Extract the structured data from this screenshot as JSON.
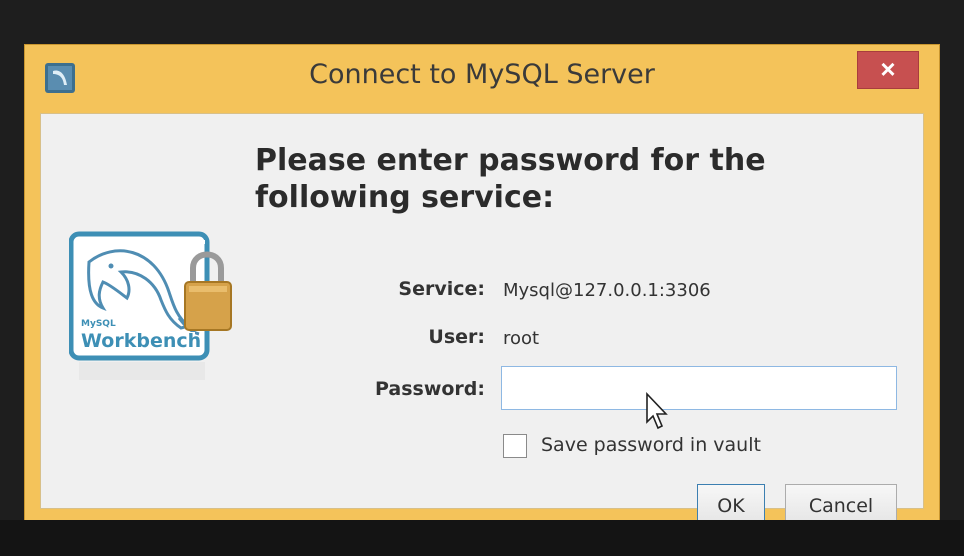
{
  "window": {
    "title": "Connect to MySQL Server",
    "close_label": "×"
  },
  "dialog": {
    "heading": "Please enter password for the following service:",
    "fields": {
      "service_label": "Service:",
      "service_value": "Mysql@127.0.0.1:3306",
      "user_label": "User:",
      "user_value": "root",
      "password_label": "Password:",
      "password_value": ""
    },
    "save_password_label": "Save password in vault",
    "save_password_checked": false,
    "ok_label": "OK",
    "cancel_label": "Cancel"
  },
  "logo": {
    "brand_small": "MySQL",
    "brand_text": "Workbench",
    "icon": "mysql-workbench-dolphin-lock"
  },
  "colors": {
    "window_frame": "#f4c35a",
    "close_button": "#c75050",
    "accent": "#3c7fb1"
  }
}
